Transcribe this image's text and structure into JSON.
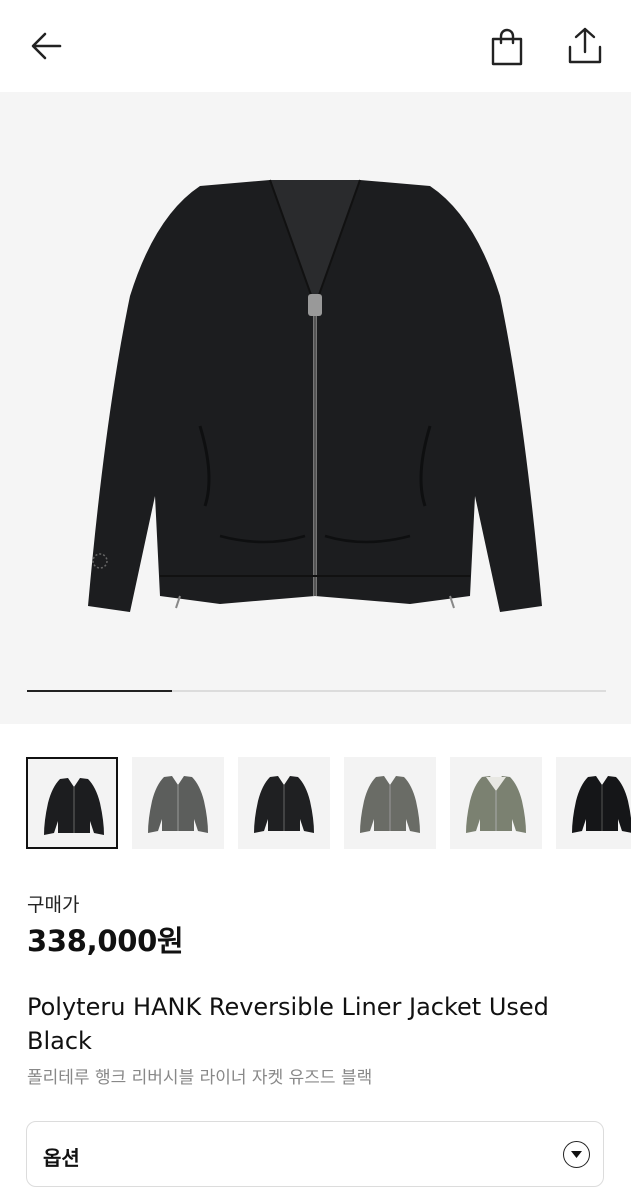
{
  "header": {
    "back_icon": "arrow-left-icon",
    "bag_icon": "shopping-bag-icon",
    "share_icon": "share-upload-icon"
  },
  "gallery": {
    "progress": 0.25,
    "thumbnail_colors": [
      "black",
      "gray",
      "black",
      "olive-gray",
      "khaki",
      "black"
    ]
  },
  "product": {
    "price_label": "구매가",
    "price": "338,000원",
    "title_en": "Polyteru HANK Reversible Liner Jacket Used Black",
    "title_ko": "폴리테루 행크 리버시블 라이너 자켓 유즈드 블랙"
  },
  "options": {
    "label": "옵션",
    "chevron_icon": "chevron-down-icon"
  },
  "colors": {
    "hero_bg": "#f5f5f5",
    "jacket_black": "#1c1d1f",
    "jacket_gray": "#5c5e5c",
    "jacket_olive": "#6a6c66",
    "jacket_khaki": "#7b8171"
  }
}
